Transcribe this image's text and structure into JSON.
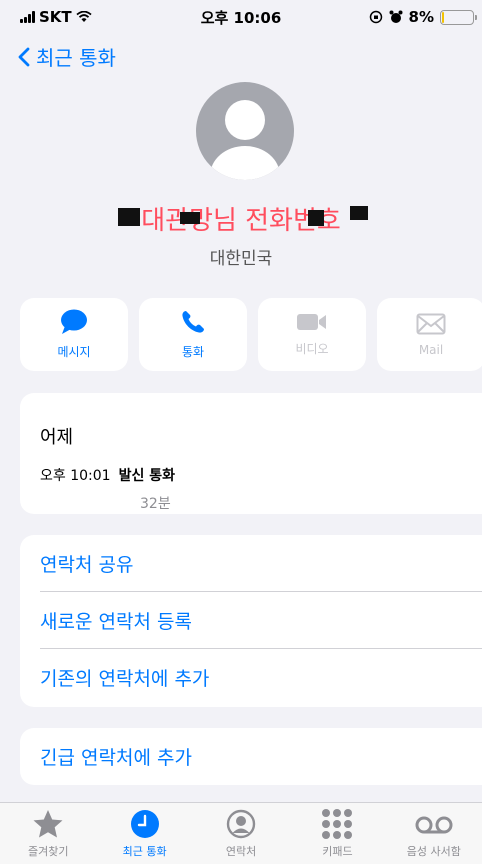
{
  "status_bar": {
    "carrier": "SKT",
    "time": "오후 10:06",
    "battery": "8%",
    "battery_level": 0.08
  },
  "nav": {
    "back_label": "최근 통화"
  },
  "contact": {
    "name": "대관망님 전화번호",
    "country": "대한민국"
  },
  "actions": [
    {
      "label": "메시지",
      "icon": "message-icon",
      "enabled": true
    },
    {
      "label": "통화",
      "icon": "phone-icon",
      "enabled": true
    },
    {
      "label": "비디오",
      "icon": "video-icon",
      "enabled": false
    },
    {
      "label": "Mail",
      "icon": "mail-icon",
      "enabled": false
    }
  ],
  "history": {
    "day": "어제",
    "time": "오후 10:01",
    "type": "발신 통화",
    "duration": "32분"
  },
  "options": {
    "share": "연락처 공유",
    "new_contact": "새로운 연락처 등록",
    "add_existing": "기존의 연락처에 추가",
    "emergency": "긴급 연락처에 추가"
  },
  "tabs": [
    {
      "label": "즐겨찾기",
      "icon": "star-icon"
    },
    {
      "label": "최근 통화",
      "icon": "clock-icon",
      "active": true
    },
    {
      "label": "연락처",
      "icon": "person-circle-icon"
    },
    {
      "label": "키패드",
      "icon": "keypad-icon"
    },
    {
      "label": "음성 사서함",
      "icon": "voicemail-icon"
    }
  ],
  "colors": {
    "accent": "#007aff",
    "background": "#f2f2f7",
    "name_overlay": "#ff4d5e"
  }
}
